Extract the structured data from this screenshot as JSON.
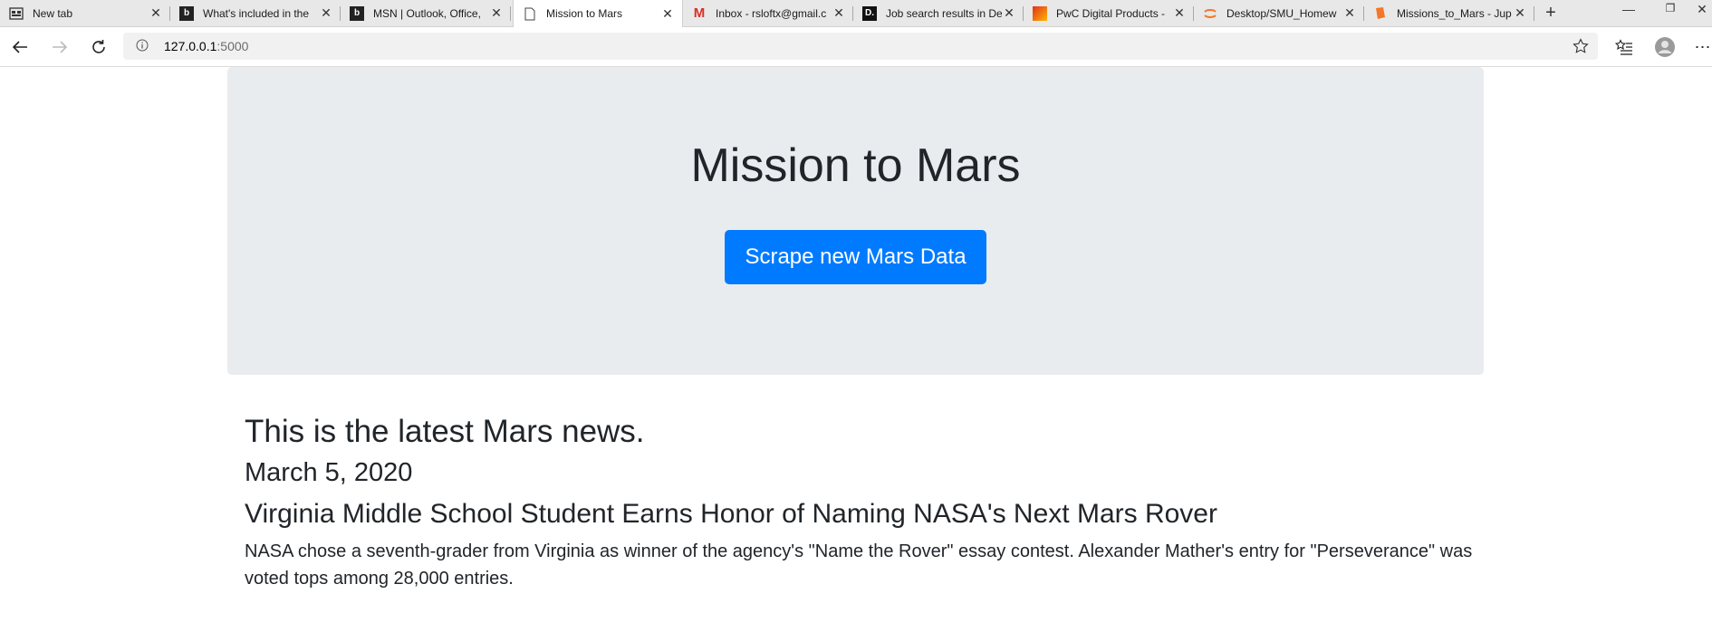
{
  "browser": {
    "tabs": [
      {
        "label": "New tab",
        "favicon": "newtab-icon"
      },
      {
        "label": "What's included in the",
        "favicon": "bing-icon"
      },
      {
        "label": "MSN | Outlook, Office,",
        "favicon": "bing-icon"
      },
      {
        "label": "Mission to Mars",
        "favicon": "page-icon",
        "active": true
      },
      {
        "label": "Inbox - rsloftx@gmail.c",
        "favicon": "gmail-icon"
      },
      {
        "label": "Job search results in De",
        "favicon": "dice-icon"
      },
      {
        "label": "PwC Digital Products -",
        "favicon": "pwc-icon"
      },
      {
        "label": "Desktop/SMU_Homew",
        "favicon": "jupyter-icon"
      },
      {
        "label": "Missions_to_Mars - Jup",
        "favicon": "jupyter-book-icon"
      }
    ],
    "address": {
      "host": "127.0.0.1",
      "port": ":5000"
    }
  },
  "page": {
    "title": "Mission to Mars",
    "scrape_button": "Scrape new Mars Data",
    "news_heading": "This is the latest Mars news.",
    "news_date": "March 5, 2020",
    "news_title": "Virginia Middle School Student Earns Honor of Naming NASA's Next Mars Rover",
    "news_paragraph": "NASA chose a seventh-grader from Virginia as winner of the agency's \"Name the Rover\" essay contest. Alexander Mather's entry for \"Perseverance\" was voted tops among 28,000 entries."
  },
  "colors": {
    "primary": "#007bff",
    "jumbotron": "#e9ecef",
    "text": "#212529"
  }
}
